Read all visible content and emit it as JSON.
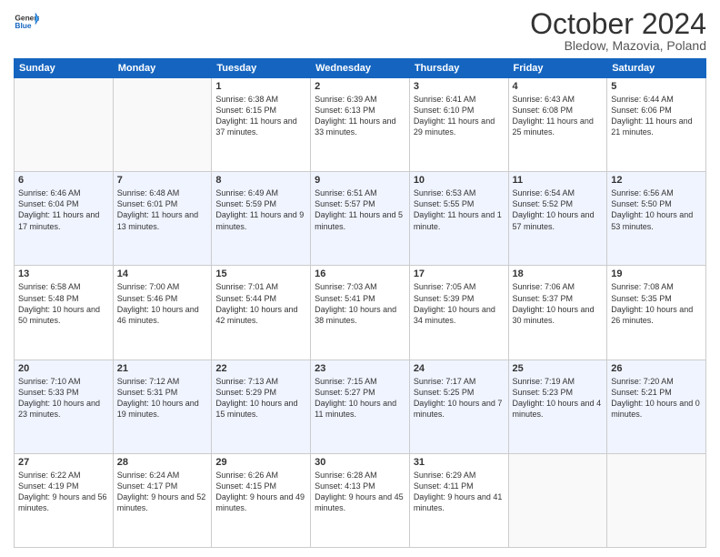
{
  "header": {
    "logo_general": "General",
    "logo_blue": "Blue",
    "month": "October 2024",
    "location": "Bledow, Mazovia, Poland"
  },
  "weekdays": [
    "Sunday",
    "Monday",
    "Tuesday",
    "Wednesday",
    "Thursday",
    "Friday",
    "Saturday"
  ],
  "weeks": [
    [
      {
        "day": "",
        "info": ""
      },
      {
        "day": "",
        "info": ""
      },
      {
        "day": "1",
        "info": "Sunrise: 6:38 AM\nSunset: 6:15 PM\nDaylight: 11 hours and 37 minutes."
      },
      {
        "day": "2",
        "info": "Sunrise: 6:39 AM\nSunset: 6:13 PM\nDaylight: 11 hours and 33 minutes."
      },
      {
        "day": "3",
        "info": "Sunrise: 6:41 AM\nSunset: 6:10 PM\nDaylight: 11 hours and 29 minutes."
      },
      {
        "day": "4",
        "info": "Sunrise: 6:43 AM\nSunset: 6:08 PM\nDaylight: 11 hours and 25 minutes."
      },
      {
        "day": "5",
        "info": "Sunrise: 6:44 AM\nSunset: 6:06 PM\nDaylight: 11 hours and 21 minutes."
      }
    ],
    [
      {
        "day": "6",
        "info": "Sunrise: 6:46 AM\nSunset: 6:04 PM\nDaylight: 11 hours and 17 minutes."
      },
      {
        "day": "7",
        "info": "Sunrise: 6:48 AM\nSunset: 6:01 PM\nDaylight: 11 hours and 13 minutes."
      },
      {
        "day": "8",
        "info": "Sunrise: 6:49 AM\nSunset: 5:59 PM\nDaylight: 11 hours and 9 minutes."
      },
      {
        "day": "9",
        "info": "Sunrise: 6:51 AM\nSunset: 5:57 PM\nDaylight: 11 hours and 5 minutes."
      },
      {
        "day": "10",
        "info": "Sunrise: 6:53 AM\nSunset: 5:55 PM\nDaylight: 11 hours and 1 minute."
      },
      {
        "day": "11",
        "info": "Sunrise: 6:54 AM\nSunset: 5:52 PM\nDaylight: 10 hours and 57 minutes."
      },
      {
        "day": "12",
        "info": "Sunrise: 6:56 AM\nSunset: 5:50 PM\nDaylight: 10 hours and 53 minutes."
      }
    ],
    [
      {
        "day": "13",
        "info": "Sunrise: 6:58 AM\nSunset: 5:48 PM\nDaylight: 10 hours and 50 minutes."
      },
      {
        "day": "14",
        "info": "Sunrise: 7:00 AM\nSunset: 5:46 PM\nDaylight: 10 hours and 46 minutes."
      },
      {
        "day": "15",
        "info": "Sunrise: 7:01 AM\nSunset: 5:44 PM\nDaylight: 10 hours and 42 minutes."
      },
      {
        "day": "16",
        "info": "Sunrise: 7:03 AM\nSunset: 5:41 PM\nDaylight: 10 hours and 38 minutes."
      },
      {
        "day": "17",
        "info": "Sunrise: 7:05 AM\nSunset: 5:39 PM\nDaylight: 10 hours and 34 minutes."
      },
      {
        "day": "18",
        "info": "Sunrise: 7:06 AM\nSunset: 5:37 PM\nDaylight: 10 hours and 30 minutes."
      },
      {
        "day": "19",
        "info": "Sunrise: 7:08 AM\nSunset: 5:35 PM\nDaylight: 10 hours and 26 minutes."
      }
    ],
    [
      {
        "day": "20",
        "info": "Sunrise: 7:10 AM\nSunset: 5:33 PM\nDaylight: 10 hours and 23 minutes."
      },
      {
        "day": "21",
        "info": "Sunrise: 7:12 AM\nSunset: 5:31 PM\nDaylight: 10 hours and 19 minutes."
      },
      {
        "day": "22",
        "info": "Sunrise: 7:13 AM\nSunset: 5:29 PM\nDaylight: 10 hours and 15 minutes."
      },
      {
        "day": "23",
        "info": "Sunrise: 7:15 AM\nSunset: 5:27 PM\nDaylight: 10 hours and 11 minutes."
      },
      {
        "day": "24",
        "info": "Sunrise: 7:17 AM\nSunset: 5:25 PM\nDaylight: 10 hours and 7 minutes."
      },
      {
        "day": "25",
        "info": "Sunrise: 7:19 AM\nSunset: 5:23 PM\nDaylight: 10 hours and 4 minutes."
      },
      {
        "day": "26",
        "info": "Sunrise: 7:20 AM\nSunset: 5:21 PM\nDaylight: 10 hours and 0 minutes."
      }
    ],
    [
      {
        "day": "27",
        "info": "Sunrise: 6:22 AM\nSunset: 4:19 PM\nDaylight: 9 hours and 56 minutes."
      },
      {
        "day": "28",
        "info": "Sunrise: 6:24 AM\nSunset: 4:17 PM\nDaylight: 9 hours and 52 minutes."
      },
      {
        "day": "29",
        "info": "Sunrise: 6:26 AM\nSunset: 4:15 PM\nDaylight: 9 hours and 49 minutes."
      },
      {
        "day": "30",
        "info": "Sunrise: 6:28 AM\nSunset: 4:13 PM\nDaylight: 9 hours and 45 minutes."
      },
      {
        "day": "31",
        "info": "Sunrise: 6:29 AM\nSunset: 4:11 PM\nDaylight: 9 hours and 41 minutes."
      },
      {
        "day": "",
        "info": ""
      },
      {
        "day": "",
        "info": ""
      }
    ]
  ]
}
